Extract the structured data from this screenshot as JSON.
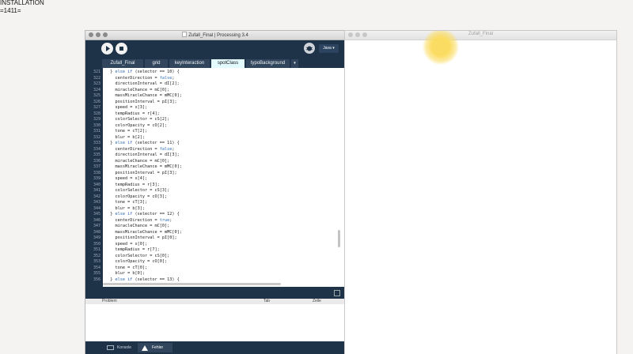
{
  "caption": {
    "line1": "INSTALLATION",
    "line2": "=1411="
  },
  "ide": {
    "title": "Zufall_Final | Processing 3.4",
    "mode": "Java ▾",
    "tabs": [
      "Zufall_Final",
      "grid",
      "keyInteraction",
      "spotClass",
      "typoBackground"
    ],
    "active_tab": "spotClass",
    "tab_menu": "▾",
    "line_numbers": [
      "321",
      "322",
      "323",
      "324",
      "325",
      "326",
      "327",
      "328",
      "329",
      "330",
      "331",
      "332",
      "333",
      "334",
      "335",
      "336",
      "337",
      "338",
      "339",
      "340",
      "341",
      "342",
      "343",
      "344",
      "345",
      "346",
      "347",
      "348",
      "349",
      "350",
      "351",
      "352",
      "353",
      "354",
      "355",
      "356"
    ],
    "code": [
      "  } else if (selector == 10) {",
      "    centerDirection = false;",
      "    directionInterval = dI[2];",
      "    miracleChance = mC[0];",
      "    massMiracleChance = mMC[0];",
      "    positionInterval = pI[3];",
      "    speed = s[3];",
      "    tempRadius = r[4];",
      "    colorSelector = cS[2];",
      "    colorOpacity = cO[2];",
      "    tone = cT[2];",
      "    blur = b[2];",
      "  } else if (selector == 11) {",
      "    centerDirection = false;",
      "    directionInterval = dI[3];",
      "    miracleChance = mC[0];",
      "    massMiracleChance = mMC[0];",
      "    positionInterval = pI[3];",
      "    speed = s[4];",
      "    tempRadius = r[3];",
      "    colorSelector = cS[3];",
      "    colorOpacity = cO[3];",
      "    tone = cT[3];",
      "    blur = b[3];",
      "  } else if (selector == 12) {",
      "    centerDirection = true;",
      "    miracleChance = mC[0];",
      "    massMiracleChance = mMC[0];",
      "    positionInterval = pI[0];",
      "    speed = s[0];",
      "    tempRadius = r[7];",
      "    colorSelector = cS[0];",
      "    colorOpacity = cO[0];",
      "    tone = cT[0];",
      "    blur = b[0];",
      "  } else if (selector == 13) {"
    ],
    "error_header": {
      "problem": "Problem",
      "tab": "Tab",
      "line": "Zeile"
    },
    "bottom_tabs": {
      "console": "Konsole",
      "errors": "Fehler"
    }
  },
  "sketch": {
    "title": "Zufall_Final",
    "dot_color": "#fbdc62"
  },
  "colors": {
    "toolbar": "#1e3248",
    "tab": "#31465d",
    "active_tab": "#e3fbff"
  }
}
